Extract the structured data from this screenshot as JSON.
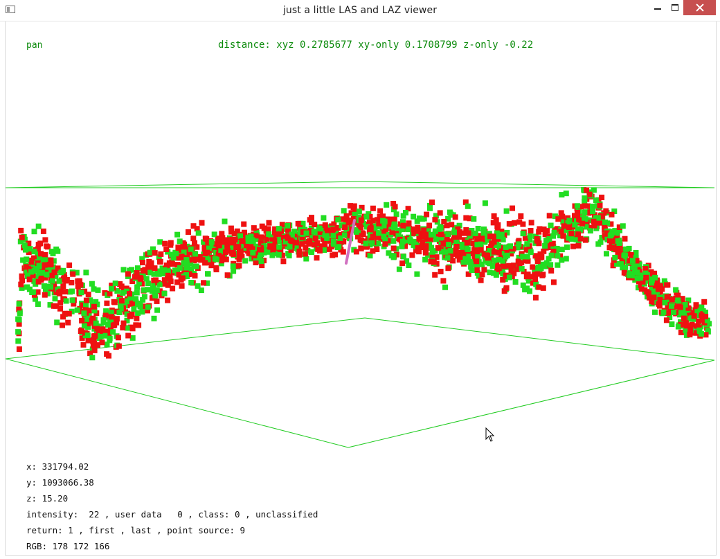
{
  "window": {
    "title": "just a little LAS and LAZ viewer"
  },
  "overlay": {
    "mode": "pan",
    "distance": "distance: xyz 0.2785677 xy-only 0.1708799 z-only -0.22"
  },
  "info": {
    "x": "x: 331794.02",
    "y": "y: 1093066.38",
    "z": "z: 15.20",
    "intensity": "intensity:  22 , user data   0 , class: 0 , unclassified",
    "return": "return: 1 , first , last , point source: 9",
    "rgb": "RGB: 178 172 166"
  },
  "colors": {
    "point_a": "#ee1111",
    "point_b": "#22dd22",
    "box_lines": "#22cc22",
    "measure_line": "#d070c0",
    "overlay_text": "#0a8a0a"
  }
}
